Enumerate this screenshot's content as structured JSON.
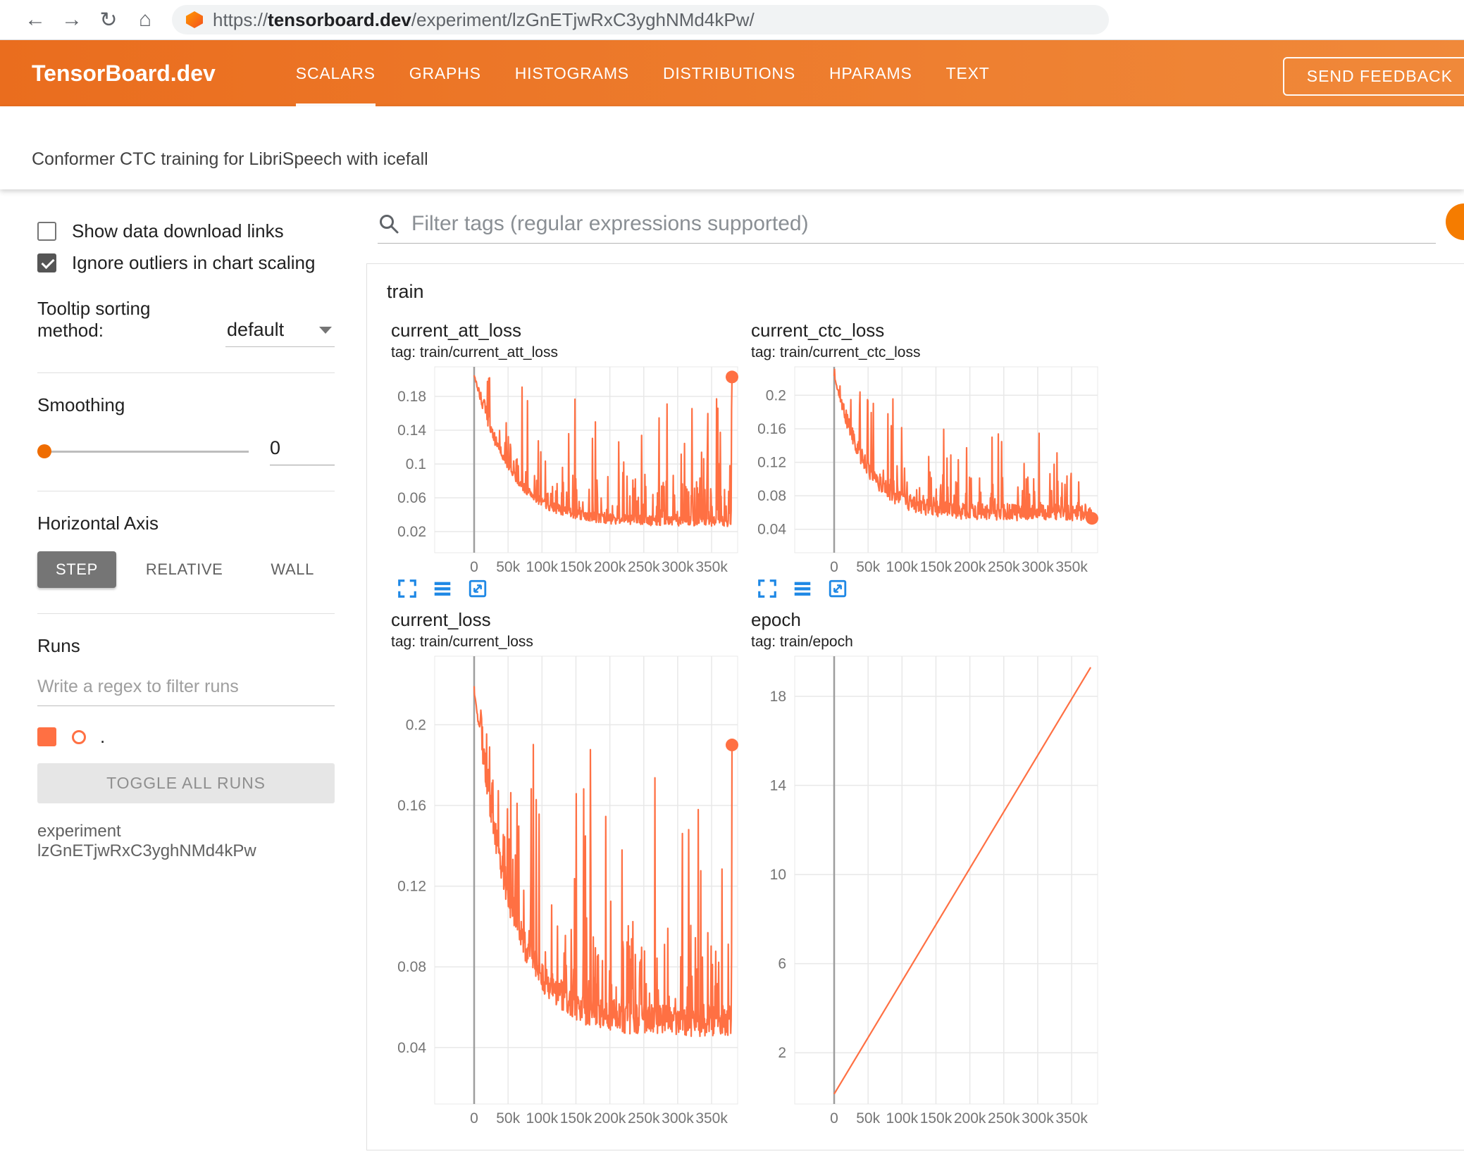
{
  "browser": {
    "back": "←",
    "forward": "→",
    "reload": "↻",
    "home": "⌂",
    "url_scheme": "https://",
    "url_host": "tensorboard.dev",
    "url_path": "/experiment/lzGnETjwRxC3yghNMd4kPw/"
  },
  "header": {
    "logo": "TensorBoard.dev",
    "tabs": [
      {
        "label": "SCALARS",
        "active": true
      },
      {
        "label": "GRAPHS",
        "active": false
      },
      {
        "label": "HISTOGRAMS",
        "active": false
      },
      {
        "label": "DISTRIBUTIONS",
        "active": false
      },
      {
        "label": "HPARAMS",
        "active": false
      },
      {
        "label": "TEXT",
        "active": false
      }
    ],
    "feedback_label": "SEND FEEDBACK"
  },
  "subtitle": "Conformer CTC training for LibriSpeech with icefall",
  "sidebar": {
    "show_download_label": "Show data download links",
    "show_download_checked": false,
    "ignore_outliers_label": "Ignore outliers in chart scaling",
    "ignore_outliers_checked": true,
    "tooltip_sort_label": "Tooltip sorting method:",
    "tooltip_sort_value": "default",
    "smoothing_label": "Smoothing",
    "smoothing_value": "0",
    "haxis_label": "Horizontal Axis",
    "haxis_options": [
      "STEP",
      "RELATIVE",
      "WALL"
    ],
    "haxis_active": "STEP",
    "runs_label": "Runs",
    "runs_filter_placeholder": "Write a regex to filter runs",
    "run_item_label": ".",
    "run_item_checked": true,
    "run_color": "#ff7043",
    "toggle_all_label": "TOGGLE ALL RUNS",
    "experiment_note": "experiment lzGnETjwRxC3yghNMd4kPw"
  },
  "main": {
    "filter_placeholder": "Filter tags (regular expressions supported)",
    "group_label": "train"
  },
  "colors": {
    "appbar_orange": "#ee7521",
    "run_line": "#ff7043",
    "tool_icon_blue": "#1e88e5",
    "grid_line": "#e8e8e8",
    "zero_axis": "#9e9e9e",
    "tick_text": "#757575"
  },
  "chart_data": [
    {
      "id": "current_att_loss",
      "type": "line",
      "title": "current_att_loss",
      "tag": "tag: train/current_att_loss",
      "x_max": 380000,
      "x_ticks": [
        0,
        50000,
        100000,
        150000,
        200000,
        250000,
        300000,
        350000
      ],
      "x_tick_labels": [
        "0",
        "50k",
        "100k",
        "150k",
        "200k",
        "250k",
        "300k",
        "350k"
      ],
      "y_ticks": [
        0.02,
        0.06,
        0.1,
        0.14,
        0.18
      ],
      "y_tick_labels": [
        "0.02",
        "0.06",
        "0.1",
        "0.14",
        "0.18"
      ],
      "y_range": [
        -0.005,
        0.215
      ],
      "grid": true,
      "legend": "none",
      "end_dot": true,
      "series": {
        "name": ".",
        "color": "#ff7043",
        "profile": {
          "kind": "noisy_loss",
          "seed": 7,
          "points": 620,
          "start": 0.205,
          "floor": 0.026,
          "tau": 0.13,
          "noise": 0.012,
          "spike_prob": 0.11,
          "spike_max": 0.205,
          "spike_decay": 0.85,
          "end": 0.203
        }
      }
    },
    {
      "id": "current_ctc_loss",
      "type": "line",
      "title": "current_ctc_loss",
      "tag": "tag: train/current_ctc_loss",
      "x_max": 380000,
      "x_ticks": [
        0,
        50000,
        100000,
        150000,
        200000,
        250000,
        300000,
        350000
      ],
      "x_tick_labels": [
        "0",
        "50k",
        "100k",
        "150k",
        "200k",
        "250k",
        "300k",
        "350k"
      ],
      "y_ticks": [
        0.04,
        0.08,
        0.12,
        0.16,
        0.2
      ],
      "y_tick_labels": [
        "0.04",
        "0.08",
        "0.12",
        "0.16",
        "0.2"
      ],
      "y_range": [
        0.012,
        0.234
      ],
      "grid": true,
      "legend": "none",
      "end_dot": true,
      "series": {
        "name": ".",
        "color": "#ff7043",
        "profile": {
          "kind": "noisy_loss",
          "seed": 19,
          "points": 620,
          "start": 0.225,
          "floor": 0.05,
          "tau": 0.11,
          "noise": 0.02,
          "spike_prob": 0.1,
          "spike_max": 0.215,
          "spike_decay": 0.8,
          "end": 0.053
        }
      }
    },
    {
      "id": "current_loss",
      "type": "line",
      "title": "current_loss",
      "tag": "tag: train/current_loss",
      "x_max": 380000,
      "x_ticks": [
        0,
        50000,
        100000,
        150000,
        200000,
        250000,
        300000,
        350000
      ],
      "x_tick_labels": [
        "0",
        "50k",
        "100k",
        "150k",
        "200k",
        "250k",
        "300k",
        "350k"
      ],
      "y_ticks": [
        0.04,
        0.08,
        0.12,
        0.16,
        0.2
      ],
      "y_tick_labels": [
        "0.04",
        "0.08",
        "0.12",
        "0.16",
        "0.2"
      ],
      "y_range": [
        0.012,
        0.234
      ],
      "grid": true,
      "legend": "none",
      "end_dot": true,
      "series": {
        "name": ".",
        "color": "#ff7043",
        "profile": {
          "kind": "noisy_loss",
          "seed": 5,
          "points": 620,
          "start": 0.22,
          "floor": 0.045,
          "tau": 0.13,
          "noise": 0.016,
          "spike_prob": 0.11,
          "spike_max": 0.21,
          "spike_decay": 0.85,
          "end": 0.19
        }
      }
    },
    {
      "id": "epoch",
      "type": "line",
      "title": "epoch",
      "tag": "tag: train/epoch",
      "x_max": 380000,
      "x_ticks": [
        0,
        50000,
        100000,
        150000,
        200000,
        250000,
        300000,
        350000
      ],
      "x_tick_labels": [
        "0",
        "50k",
        "100k",
        "150k",
        "200k",
        "250k",
        "300k",
        "350k"
      ],
      "y_ticks": [
        2,
        6,
        10,
        14,
        18
      ],
      "y_tick_labels": [
        "2",
        "6",
        "10",
        "14",
        "18"
      ],
      "y_range": [
        -0.3,
        19.8
      ],
      "grid": true,
      "legend": "none",
      "end_dot": false,
      "series": {
        "name": ".",
        "color": "#ff7043",
        "profile": {
          "kind": "linear",
          "x0": 0,
          "y0": 0.15,
          "x1": 378000,
          "y1": 19.3
        }
      }
    }
  ]
}
